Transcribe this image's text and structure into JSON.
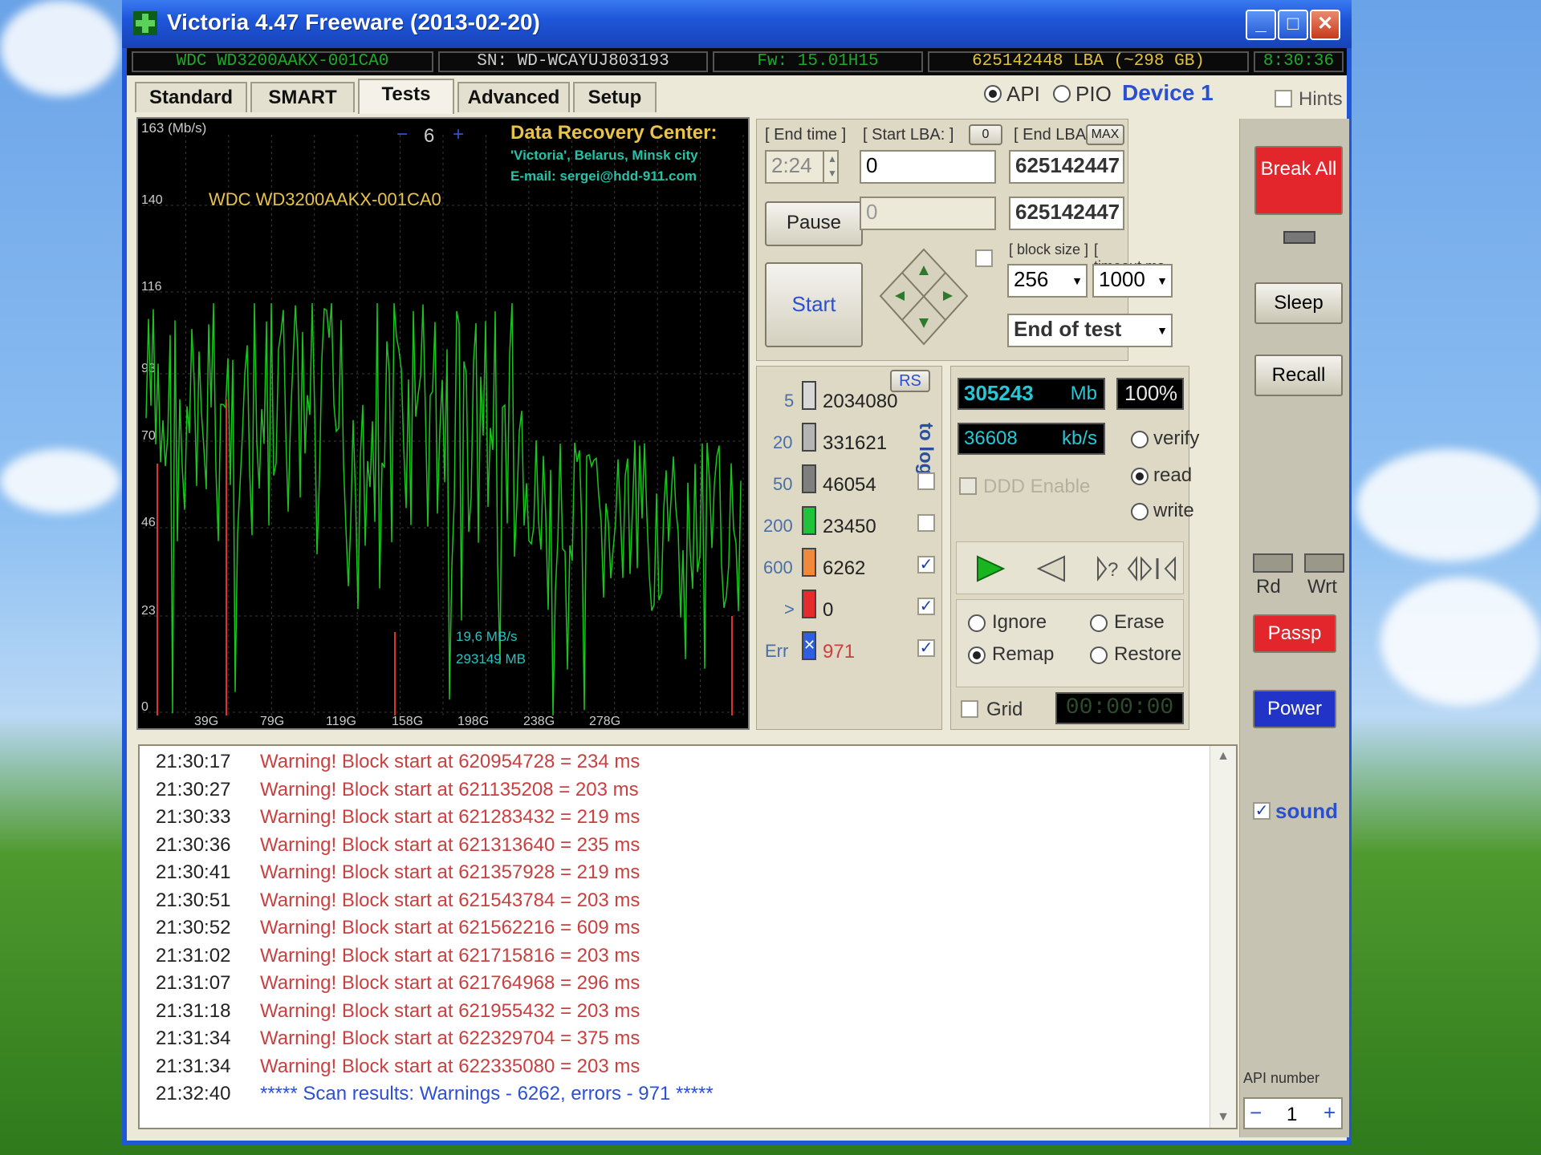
{
  "window": {
    "title": "Victoria 4.47  Freeware (2013-02-20)"
  },
  "infobar": {
    "model": "WDC WD3200AAKX-001CA0",
    "serial": "SN: WD-WCAYUJ803193",
    "firmware": "Fw: 15.01H15",
    "lba": "625142448 LBA (~298 GB)",
    "clock": "8:30:36"
  },
  "tabs": [
    "Standard",
    "SMART",
    "Tests",
    "Advanced",
    "Setup"
  ],
  "mode": {
    "api": "API",
    "pio": "PIO",
    "device": "Device 1",
    "hints": "Hints"
  },
  "graph": {
    "unit": "163 (Mb/s)",
    "scale_minus": "−",
    "scale_value": "6",
    "scale_plus": "+",
    "center_title": "Data Recovery Center:",
    "center_line1": "'Victoria', Belarus, Minsk city",
    "center_line2": "E-mail: sergei@hdd-911.com",
    "drive_label": "WDC WD3200AAKX-001CA0",
    "y_ticks": [
      "140",
      "116",
      "93",
      "70",
      "46",
      "23",
      "0"
    ],
    "x_ticks": [
      "39G",
      "79G",
      "119G",
      "158G",
      "198G",
      "238G",
      "278G"
    ],
    "cursor_speed": "19,6 MB/s",
    "cursor_pos": "293149 MB"
  },
  "controls": {
    "end_time_label": "[ End time ]",
    "end_time": "2:24",
    "start_lba_label": "[ Start LBA: ]",
    "start_lba_btn": "0",
    "end_lba_label": "[ End LBA: ]",
    "end_lba_btn": "MAX",
    "start_lba": "0",
    "end_lba": "625142447",
    "cur_lba": "0",
    "end_lba2": "625142447",
    "pause": "Pause",
    "start": "Start",
    "block_size_label": "[ block size ]",
    "timeout_label": "[ timeout,ms ]",
    "block_size": "256",
    "timeout": "1000",
    "end_action": "End of test"
  },
  "counters": {
    "rs": "RS",
    "to_log": "to log:",
    "rows": [
      {
        "label": "5",
        "value": "2034080",
        "color": "#d8d8d8"
      },
      {
        "label": "20",
        "value": "331621",
        "color": "#b5b5b5"
      },
      {
        "label": "50",
        "value": "46054",
        "color": "#7f7f7f"
      },
      {
        "label": "200",
        "value": "23450",
        "color": "#1fc23a"
      },
      {
        "label": "600",
        "value": "6262",
        "color": "#f08a3a"
      },
      {
        "label": ">",
        "value": "0",
        "color": "#e52c2c"
      },
      {
        "label": "Err",
        "value": "971",
        "color": "#2d5fe0"
      }
    ]
  },
  "status": {
    "mb_value": "305243",
    "mb_unit": "Mb",
    "percent_value": "100",
    "percent_unit": "%",
    "speed_value": "36608",
    "speed_unit": "kb/s",
    "verify": "verify",
    "read": "read",
    "write": "write",
    "ddd": "DDD Enable",
    "ignore": "Ignore",
    "erase": "Erase",
    "remap": "Remap",
    "restore": "Restore",
    "grid": "Grid",
    "timer": "00:00:00"
  },
  "sidebar": {
    "break_all": "Break All",
    "sleep": "Sleep",
    "recall": "Recall",
    "rd": "Rd",
    "wrt": "Wrt",
    "passp": "Passp",
    "power": "Power",
    "sound": "sound",
    "api_number_label": "API number",
    "api_minus": "−",
    "api_number": "1",
    "api_plus": "+"
  },
  "log": [
    {
      "time": "21:30:17",
      "msg": "Warning! Block start at 620954728 = 234 ms"
    },
    {
      "time": "21:30:27",
      "msg": "Warning! Block start at 621135208 = 203 ms"
    },
    {
      "time": "21:30:33",
      "msg": "Warning! Block start at 621283432 = 219 ms"
    },
    {
      "time": "21:30:36",
      "msg": "Warning! Block start at 621313640 = 235 ms"
    },
    {
      "time": "21:30:41",
      "msg": "Warning! Block start at 621357928 = 219 ms"
    },
    {
      "time": "21:30:51",
      "msg": "Warning! Block start at 621543784 = 203 ms"
    },
    {
      "time": "21:30:52",
      "msg": "Warning! Block start at 621562216 = 609 ms"
    },
    {
      "time": "21:31:02",
      "msg": "Warning! Block start at 621715816 = 203 ms"
    },
    {
      "time": "21:31:07",
      "msg": "Warning! Block start at 621764968 = 296 ms"
    },
    {
      "time": "21:31:18",
      "msg": "Warning! Block start at 621955432 = 203 ms"
    },
    {
      "time": "21:31:34",
      "msg": "Warning! Block start at 622329704 = 375 ms"
    },
    {
      "time": "21:31:34",
      "msg": "Warning! Block start at 622335080 = 203 ms"
    },
    {
      "time": "21:32:40",
      "msg": "***** Scan results: Warnings - 6262, errors - 971 *****"
    }
  ],
  "colors": {
    "title_bar": "#1e56d9",
    "graph_line": "#19c41e",
    "warning_text": "#c94040",
    "result_text": "#2c4fd6",
    "break_all": "#e3262b",
    "power": "#2233c8"
  }
}
